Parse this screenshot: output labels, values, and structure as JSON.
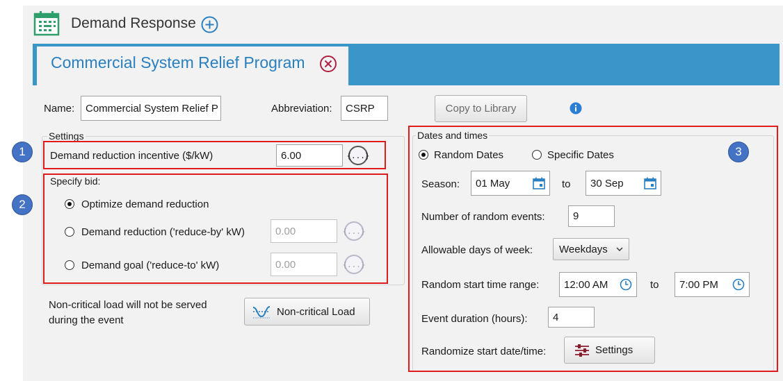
{
  "header": {
    "app_title": "Demand Response"
  },
  "tab": {
    "label": "Commercial System Relief Program"
  },
  "form": {
    "name_label": "Name:",
    "name_value": "Commercial System Relief P",
    "abbr_label": "Abbreviation:",
    "abbr_value": "CSRP",
    "copy_button": "Copy to Library"
  },
  "settings": {
    "group_label": "Settings",
    "incentive_label": "Demand reduction incentive ($/kW)",
    "incentive_value": "6.00",
    "fx_label": "{...}"
  },
  "bid": {
    "label": "Specify bid:",
    "options": [
      {
        "label": "Optimize demand reduction"
      },
      {
        "label": "Demand reduction ('reduce-by' kW)",
        "value": "0.00"
      },
      {
        "label": "Demand goal ('reduce-to' kW)",
        "value": "0.00"
      }
    ]
  },
  "noncritical": {
    "text_line1": "Non-critical load will not be served",
    "text_line2": "during the event",
    "button": "Non-critical Load"
  },
  "dates": {
    "group_label": "Dates and times",
    "random_label": "Random Dates",
    "specific_label": "Specific Dates",
    "season_label": "Season:",
    "season_from": "01 May",
    "season_to_label": "to",
    "season_to": "30 Sep",
    "events_label": "Number of random events:",
    "events_value": "9",
    "days_label": "Allowable days of week:",
    "days_value": "Weekdays",
    "start_label": "Random start time range:",
    "start_from": "12:00 AM",
    "start_to_label": "to",
    "start_to": "7:00 PM",
    "duration_label": "Event duration (hours):",
    "duration_value": "4",
    "randomize_label": "Randomize start date/time:",
    "settings_button": "Settings"
  },
  "badges": {
    "one": "1",
    "two": "2",
    "three": "3"
  },
  "colors": {
    "accent": "#3a95c9",
    "annotation_red": "#e01b1b",
    "badge_blue": "#4472c4",
    "icon_green": "#2e9e6b"
  }
}
